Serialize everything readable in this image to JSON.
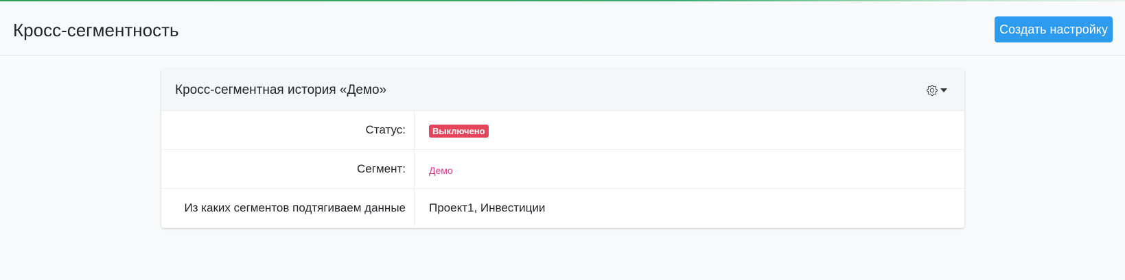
{
  "header": {
    "title": "Кросс-сегментность",
    "create_button_label": "Создать настройку"
  },
  "card": {
    "title": "Кросс-сегментная история «Демо»",
    "settings_icon": "gear-icon",
    "rows": [
      {
        "label": "Статус:",
        "value": "Выключено",
        "value_type": "badge",
        "badge_color": "#e5455a"
      },
      {
        "label": "Сегмент:",
        "value": "Демо",
        "value_type": "link",
        "link_color": "#e03a8c"
      },
      {
        "label": "Из каких сегментов подтягиваем данные",
        "value": "Проект1, Инвестиции",
        "value_type": "text"
      }
    ]
  },
  "colors": {
    "accent": "#2d9bf0",
    "top_bar": "#2e9e5b",
    "background": "#f8f9fa"
  }
}
